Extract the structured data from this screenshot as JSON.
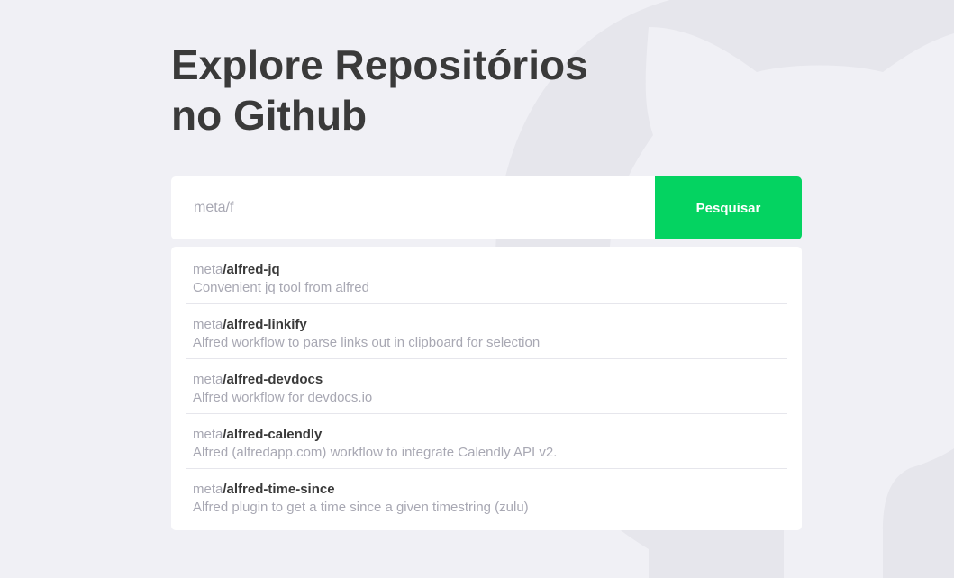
{
  "header": {
    "title_line1": "Explore Repositórios",
    "title_line2": "no Github"
  },
  "search": {
    "value": "meta/f",
    "button_label": "Pesquisar"
  },
  "colors": {
    "background": "#f0f0f5",
    "accent": "#04d361",
    "title": "#3a3a3a",
    "muted": "#a8a8b3"
  },
  "background_icon": "github-octocat-icon",
  "results": [
    {
      "owner": "meta",
      "repo": "/alfred-jq",
      "description": "Convenient jq tool from alfred"
    },
    {
      "owner": "meta",
      "repo": "/alfred-linkify",
      "description": "Alfred workflow to parse links out in clipboard for selection"
    },
    {
      "owner": "meta",
      "repo": "/alfred-devdocs",
      "description": "Alfred workflow for devdocs.io"
    },
    {
      "owner": "meta",
      "repo": "/alfred-calendly",
      "description": "Alfred (alfredapp.com) workflow to integrate Calendly API v2."
    },
    {
      "owner": "meta",
      "repo": "/alfred-time-since",
      "description": "Alfred plugin to get a time since a given timestring (zulu)"
    }
  ]
}
